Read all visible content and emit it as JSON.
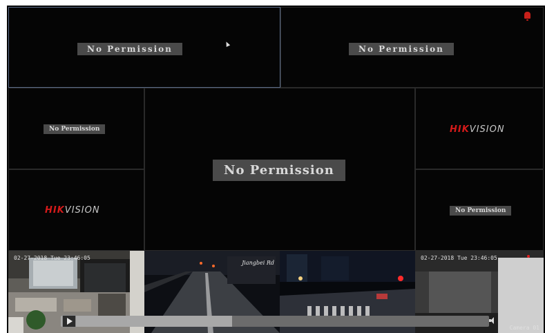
{
  "tiles": {
    "top_left": "No Permission",
    "top_right": "No Permission",
    "mid_left_top": "No Permission",
    "center": "No Permission",
    "right_bottom": "No Permission"
  },
  "logos": {
    "right_top": {
      "brand": "HIK",
      "suffix": "VISION"
    },
    "left_bottom": {
      "brand": "HIK",
      "suffix": "VISION"
    }
  },
  "thumbnails": {
    "office_timestamp": "02-27-2018 Tue 23:46:05",
    "street_label": "Jiangbei Rd",
    "night_timestamp": "02-27-2018 Tue 23:46:05",
    "camera_label": "Camera 01"
  },
  "playback": {
    "progress": 0.4
  },
  "icons": [
    "alarm-icon",
    "play-icon",
    "volume-icon",
    "mouse-cursor-icon"
  ],
  "colors": {
    "alert_red": "#d41a1a",
    "tile_bg": "#050505",
    "label_bg": "#4a4a4a"
  }
}
